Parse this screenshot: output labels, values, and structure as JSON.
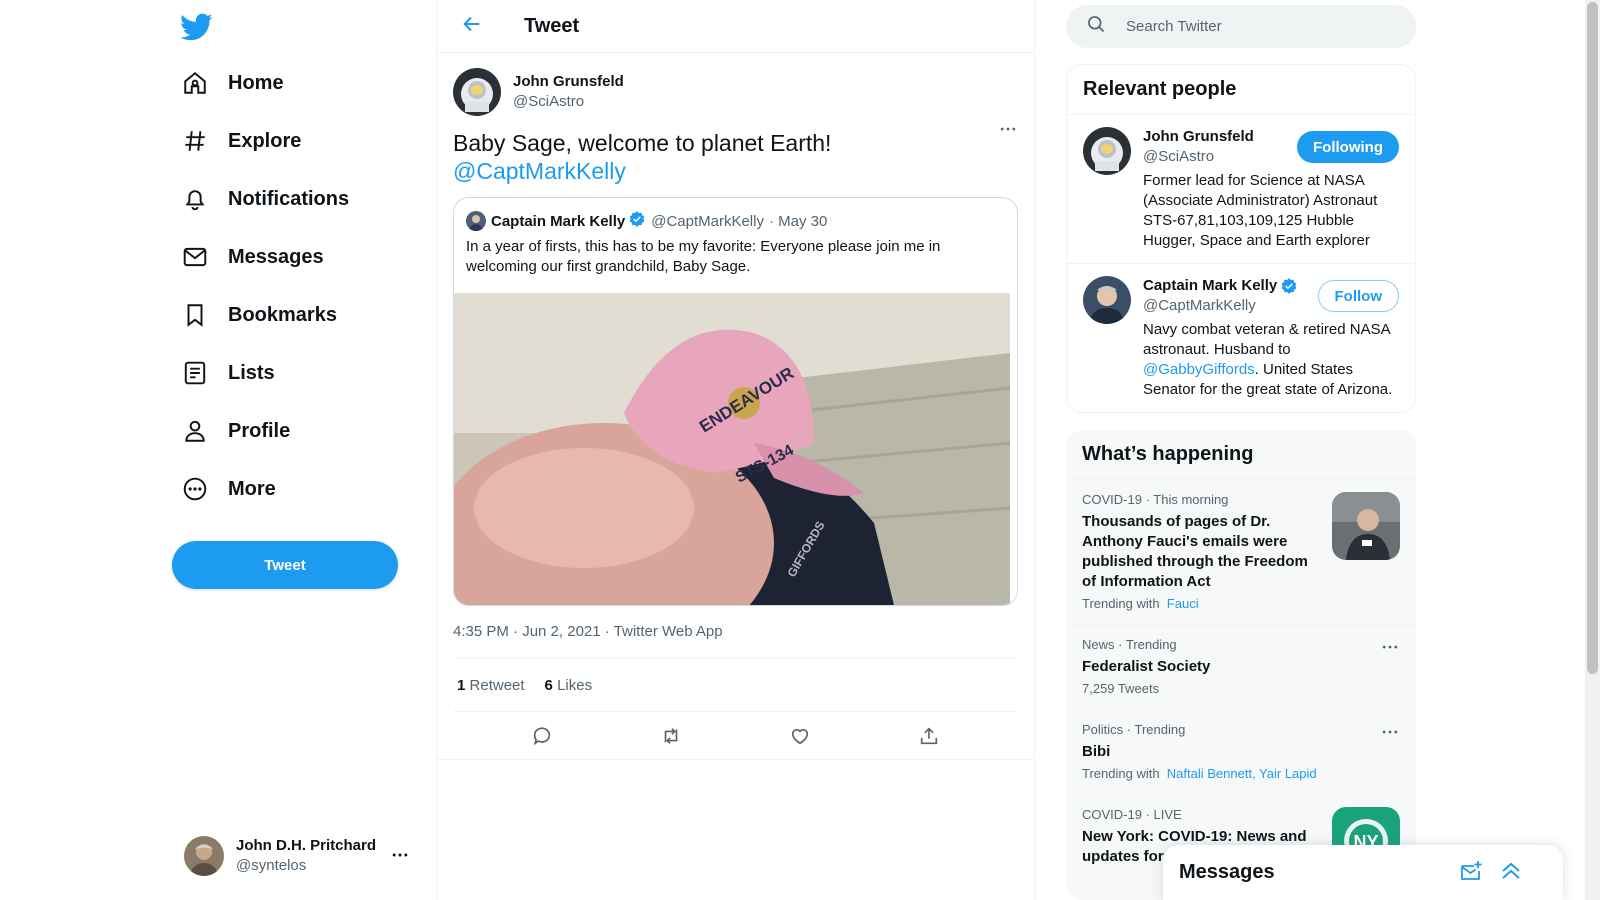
{
  "colors": {
    "accent": "#1d9bf0",
    "text": "#0f1419",
    "muted": "#536471",
    "border": "#eff3f4",
    "hat": "#e8a6bd"
  },
  "nav": {
    "logo": "twitter-bird-icon",
    "items": [
      {
        "label": "Home",
        "icon": "home-icon"
      },
      {
        "label": "Explore",
        "icon": "hashtag-icon"
      },
      {
        "label": "Notifications",
        "icon": "bell-icon"
      },
      {
        "label": "Messages",
        "icon": "mail-icon"
      },
      {
        "label": "Bookmarks",
        "icon": "bookmark-icon"
      },
      {
        "label": "Lists",
        "icon": "list-icon"
      },
      {
        "label": "Profile",
        "icon": "person-icon"
      },
      {
        "label": "More",
        "icon": "more-circle-icon"
      }
    ],
    "tweet_button": "Tweet",
    "account": {
      "name": "John D.H. Pritchard",
      "handle": "@syntelos"
    }
  },
  "center": {
    "title": "Tweet",
    "tweet": {
      "author_name": "John Grunsfeld",
      "author_handle": "@SciAstro",
      "text": "Baby Sage, welcome to planet Earth!",
      "mention": "@CaptMarkKelly",
      "quote": {
        "name": "Captain Mark Kelly",
        "handle": "@CaptMarkKelly",
        "date": "· May 30",
        "text": "In a year of firsts, this has to be my favorite: Everyone please join me in welcoming our first grandchild, Baby Sage.",
        "hat_text": "ENDEAVOUR",
        "hat_text2": "STS-134",
        "shirt_text": "GIFFORDS"
      },
      "meta": "4:35 PM · Jun 2, 2021 · Twitter Web App",
      "retweets_count": "1",
      "retweets_label": "Retweet",
      "likes_count": "6",
      "likes_label": "Likes"
    }
  },
  "right": {
    "search_placeholder": "Search Twitter",
    "people": {
      "title": "Relevant people",
      "list": [
        {
          "name": "John Grunsfeld",
          "handle": "@SciAstro",
          "button": "Following",
          "bio": "Former lead for Science at NASA (Associate Administrator) Astronaut STS-67,81,103,109,125 Hubble Hugger, Space and Earth explorer"
        },
        {
          "name": "Captain Mark Kelly",
          "handle": "@CaptMarkKelly",
          "button": "Follow",
          "bio_pre": "Navy combat veteran & retired NASA astronaut. Husband to ",
          "bio_link": "@GabbyGiffords",
          "bio_post": ". United States Senator for the great state of Arizona."
        }
      ]
    },
    "happening": {
      "title": "What’s happening",
      "trends": [
        {
          "context": "COVID-19 · This morning",
          "title": "Thousands of pages of Dr. Anthony Fauci's emails were published through the Freedom of Information Act",
          "sub_label": "Trending with",
          "sub_links": "Fauci"
        },
        {
          "context": "News · Trending",
          "title": "Federalist Society",
          "sub": "7,259 Tweets"
        },
        {
          "context": "Politics · Trending",
          "title": "Bibi",
          "sub_label": "Trending with",
          "sub_links": "Naftali Bennett, Yair Lapid"
        },
        {
          "context": "COVID-19 · LIVE",
          "title": "New York: COVID-19: News and updates for",
          "thumb_text": "NY"
        }
      ]
    }
  },
  "drawer": {
    "title": "Messages"
  }
}
